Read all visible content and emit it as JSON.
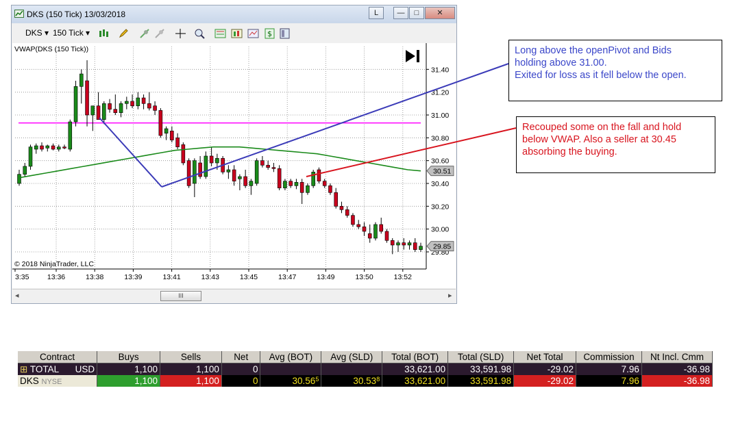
{
  "window": {
    "title": "DKS (150 Tick)  13/03/2018",
    "buttons": [
      "L",
      "—",
      "□",
      "✕"
    ]
  },
  "toolbar": {
    "instrument": "DKS ▾",
    "period": "150 Tick ▾"
  },
  "chart": {
    "indicator_label": "VWAP(DKS (150 Tick))",
    "copyright": "© 2018 NinjaTrader, LLC",
    "scroll_thumb_label": "III",
    "scroll_left": "◂",
    "scroll_right": "▸"
  },
  "chart_data": {
    "type": "candlestick",
    "y_ticks": [
      "31.40",
      "31.20",
      "31.00",
      "30.80",
      "30.60",
      "30.40",
      "30.20",
      "30.00",
      "29.80"
    ],
    "ylim": [
      29.65,
      31.6
    ],
    "x_ticks": [
      "3:35",
      "13:36",
      "13:38",
      "13:39",
      "13:41",
      "13:43",
      "13:45",
      "13:47",
      "13:49",
      "13:50",
      "13:52"
    ],
    "price_badges": [
      {
        "label": "30.51",
        "value": 30.51,
        "color": "#c0c0c0"
      },
      {
        "label": "29.85",
        "value": 29.85,
        "color": "#c0c0c0"
      }
    ],
    "horizontal_line": {
      "value": 30.93,
      "color": "#ff00ff"
    },
    "vwap_color": "#1a8a1a",
    "vwap": [
      30.45,
      30.47,
      30.49,
      30.51,
      30.53,
      30.55,
      30.57,
      30.59,
      30.61,
      30.63,
      30.65,
      30.67,
      30.69,
      30.7,
      30.71,
      30.72,
      30.72,
      30.72,
      30.71,
      30.7,
      30.69,
      30.68,
      30.67,
      30.66,
      30.64,
      30.62,
      30.6,
      30.58,
      30.56,
      30.54,
      30.52,
      30.51
    ],
    "up_color": "#1a8a1a",
    "down_color": "#c8001e",
    "candles": [
      {
        "o": 30.4,
        "h": 30.52,
        "l": 30.38,
        "c": 30.48
      },
      {
        "o": 30.48,
        "h": 30.58,
        "l": 30.46,
        "c": 30.55
      },
      {
        "o": 30.55,
        "h": 30.74,
        "l": 30.52,
        "c": 30.72
      },
      {
        "o": 30.7,
        "h": 30.75,
        "l": 30.66,
        "c": 30.73
      },
      {
        "o": 30.73,
        "h": 30.76,
        "l": 30.68,
        "c": 30.7
      },
      {
        "o": 30.71,
        "h": 30.74,
        "l": 30.68,
        "c": 30.73
      },
      {
        "o": 30.73,
        "h": 30.75,
        "l": 30.69,
        "c": 30.7
      },
      {
        "o": 30.7,
        "h": 30.74,
        "l": 30.68,
        "c": 30.72
      },
      {
        "o": 30.72,
        "h": 30.74,
        "l": 30.7,
        "c": 30.71
      },
      {
        "o": 30.7,
        "h": 30.96,
        "l": 30.68,
        "c": 30.94
      },
      {
        "o": 30.94,
        "h": 31.3,
        "l": 30.9,
        "c": 31.25
      },
      {
        "o": 31.25,
        "h": 31.4,
        "l": 31.1,
        "c": 31.36
      },
      {
        "o": 31.3,
        "h": 31.48,
        "l": 30.9,
        "c": 31.0
      },
      {
        "o": 31.0,
        "h": 31.08,
        "l": 30.86,
        "c": 31.08
      },
      {
        "o": 31.08,
        "h": 31.2,
        "l": 31.02,
        "c": 30.96
      },
      {
        "o": 30.96,
        "h": 31.12,
        "l": 30.92,
        "c": 31.1
      },
      {
        "o": 31.1,
        "h": 31.14,
        "l": 31.02,
        "c": 31.05
      },
      {
        "o": 31.05,
        "h": 31.18,
        "l": 31.0,
        "c": 31.02
      },
      {
        "o": 31.02,
        "h": 31.12,
        "l": 30.98,
        "c": 31.1
      },
      {
        "o": 31.1,
        "h": 31.16,
        "l": 31.05,
        "c": 31.12
      },
      {
        "o": 31.12,
        "h": 31.18,
        "l": 31.06,
        "c": 31.08
      },
      {
        "o": 31.08,
        "h": 31.2,
        "l": 31.05,
        "c": 31.15
      },
      {
        "o": 31.15,
        "h": 31.18,
        "l": 31.05,
        "c": 31.1
      },
      {
        "o": 31.1,
        "h": 31.2,
        "l": 31.04,
        "c": 31.06
      }
    ],
    "candles2": [
      {
        "o": 31.08,
        "h": 31.12,
        "l": 31.0,
        "c": 31.04
      },
      {
        "o": 31.04,
        "h": 31.06,
        "l": 30.8,
        "c": 30.82
      },
      {
        "o": 30.84,
        "h": 30.9,
        "l": 30.78,
        "c": 30.88
      },
      {
        "o": 30.86,
        "h": 30.9,
        "l": 30.76,
        "c": 30.78
      },
      {
        "o": 30.8,
        "h": 30.84,
        "l": 30.7,
        "c": 30.72
      },
      {
        "o": 30.74,
        "h": 30.76,
        "l": 30.56,
        "c": 30.58
      },
      {
        "o": 30.6,
        "h": 30.62,
        "l": 30.36,
        "c": 30.38
      },
      {
        "o": 30.4,
        "h": 30.62,
        "l": 30.28,
        "c": 30.6
      },
      {
        "o": 30.58,
        "h": 30.64,
        "l": 30.44,
        "c": 30.46
      },
      {
        "o": 30.46,
        "h": 30.68,
        "l": 30.44,
        "c": 30.64
      },
      {
        "o": 30.64,
        "h": 30.72,
        "l": 30.55,
        "c": 30.58
      },
      {
        "o": 30.58,
        "h": 30.66,
        "l": 30.52,
        "c": 30.62
      },
      {
        "o": 30.62,
        "h": 30.64,
        "l": 30.48,
        "c": 30.5
      },
      {
        "o": 30.5,
        "h": 30.56,
        "l": 30.44,
        "c": 30.52
      },
      {
        "o": 30.52,
        "h": 30.56,
        "l": 30.38,
        "c": 30.42
      },
      {
        "o": 30.44,
        "h": 30.48,
        "l": 30.34,
        "c": 30.46
      },
      {
        "o": 30.46,
        "h": 30.52,
        "l": 30.36,
        "c": 30.38
      },
      {
        "o": 30.38,
        "h": 30.44,
        "l": 30.3,
        "c": 30.42
      },
      {
        "o": 30.4,
        "h": 30.62,
        "l": 30.38,
        "c": 30.6
      },
      {
        "o": 30.6,
        "h": 30.64,
        "l": 30.54,
        "c": 30.56
      },
      {
        "o": 30.56,
        "h": 30.6,
        "l": 30.52,
        "c": 30.54
      },
      {
        "o": 30.54,
        "h": 30.58,
        "l": 30.5,
        "c": 30.53
      },
      {
        "o": 30.53,
        "h": 30.56,
        "l": 30.34,
        "c": 30.36
      },
      {
        "o": 30.36,
        "h": 30.44,
        "l": 30.34,
        "c": 30.42
      },
      {
        "o": 30.42,
        "h": 30.44,
        "l": 30.36,
        "c": 30.38
      },
      {
        "o": 30.38,
        "h": 30.44,
        "l": 30.35,
        "c": 30.41
      },
      {
        "o": 30.41,
        "h": 30.44,
        "l": 30.22,
        "c": 30.32
      },
      {
        "o": 30.32,
        "h": 30.4,
        "l": 30.3,
        "c": 30.38
      },
      {
        "o": 30.38,
        "h": 30.52,
        "l": 30.36,
        "c": 30.5
      },
      {
        "o": 30.52,
        "h": 30.54,
        "l": 30.4,
        "c": 30.42
      },
      {
        "o": 30.42,
        "h": 30.44,
        "l": 30.36,
        "c": 30.38
      },
      {
        "o": 30.38,
        "h": 30.4,
        "l": 30.3,
        "c": 30.32
      },
      {
        "o": 30.32,
        "h": 30.36,
        "l": 30.18,
        "c": 30.2
      },
      {
        "o": 30.2,
        "h": 30.24,
        "l": 30.14,
        "c": 30.17
      },
      {
        "o": 30.17,
        "h": 30.2,
        "l": 30.1,
        "c": 30.12
      },
      {
        "o": 30.12,
        "h": 30.14,
        "l": 30.02,
        "c": 30.04
      },
      {
        "o": 30.04,
        "h": 30.08,
        "l": 30.0,
        "c": 30.02
      },
      {
        "o": 30.02,
        "h": 30.06,
        "l": 29.94,
        "c": 29.98
      },
      {
        "o": 29.96,
        "h": 30.04,
        "l": 29.88,
        "c": 29.92
      },
      {
        "o": 29.92,
        "h": 30.06,
        "l": 29.9,
        "c": 30.04
      },
      {
        "o": 30.04,
        "h": 30.1,
        "l": 29.96,
        "c": 29.98
      },
      {
        "o": 29.98,
        "h": 30.0,
        "l": 29.88,
        "c": 29.9
      },
      {
        "o": 29.9,
        "h": 29.92,
        "l": 29.78,
        "c": 29.86
      },
      {
        "o": 29.86,
        "h": 29.9,
        "l": 29.8,
        "c": 29.88
      },
      {
        "o": 29.88,
        "h": 29.92,
        "l": 29.82,
        "c": 29.86
      },
      {
        "o": 29.86,
        "h": 29.9,
        "l": 29.82,
        "c": 29.88
      },
      {
        "o": 29.88,
        "h": 29.92,
        "l": 29.8,
        "c": 29.82
      },
      {
        "o": 29.82,
        "h": 29.88,
        "l": 29.8,
        "c": 29.85
      }
    ]
  },
  "annotations": {
    "blue_note": {
      "lines": [
        "Long above the openPivot and Bids",
        "holding above 31.00.",
        "Exited for loss as it fell below the open."
      ],
      "color": "#3b47c9",
      "line_color": "#3b3bb8"
    },
    "red_note": {
      "lines": [
        "Recouped some on the fall and hold",
        "below VWAP. Also a seller at 30.45",
        "absorbing the buying."
      ],
      "color": "#d8141e",
      "line_color": "#d8141e"
    }
  },
  "positions_table": {
    "headers": [
      "Contract",
      "Buys",
      "Sells",
      "Net",
      "Avg (BOT)",
      "Avg (SLD)",
      "Total (BOT)",
      "Total (SLD)",
      "Net Total",
      "Commission",
      "Nt Incl. Cmm"
    ],
    "total_row": {
      "expand": "⊞",
      "contract": "TOTAL",
      "currency": "USD",
      "buys": "1,100",
      "sells": "1,100",
      "net": "0",
      "avg_bot": "",
      "avg_sld": "",
      "total_bot": "33,621.00",
      "total_sld": "33,591.98",
      "net_total": "-29.02",
      "commission": "7.96",
      "nt_incl_cmm": "-36.98"
    },
    "dks_row": {
      "contract": "DKS",
      "exchange": "NYSE",
      "buys": "1,100",
      "sells": "1,100",
      "net": "0",
      "avg_bot": "30.56",
      "avg_bot_frac": "5",
      "avg_sld": "30.53",
      "avg_sld_frac": "8",
      "total_bot": "33,621.00",
      "total_sld": "33,591.98",
      "net_total": "-29.02",
      "commission": "7.96",
      "nt_incl_cmm": "-36.98"
    }
  }
}
